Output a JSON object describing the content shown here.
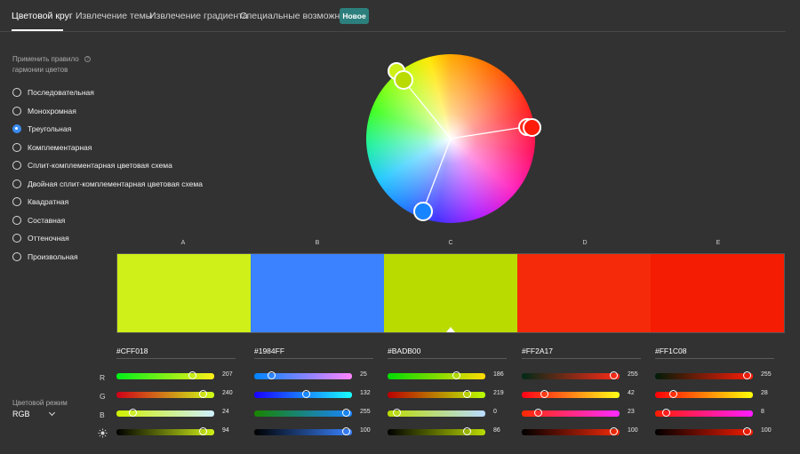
{
  "tabs": [
    {
      "label": "Цветовой круг",
      "active": true
    },
    {
      "label": "Извлечение темы",
      "active": false
    },
    {
      "label": "Извлечение градиента",
      "active": false
    },
    {
      "label": "Специальные возможности",
      "active": false
    }
  ],
  "badge": "Новое",
  "harmony": {
    "title": "Применить правило гармонии цветов",
    "rules": [
      {
        "label": "Последовательная",
        "checked": false
      },
      {
        "label": "Монохромная",
        "checked": false
      },
      {
        "label": "Треугольная",
        "checked": true
      },
      {
        "label": "Комплементарная",
        "checked": false
      },
      {
        "label": "Сплит-комплементарная цветовая схема",
        "checked": false
      },
      {
        "label": "Двойная сплит-комплементарная цветовая схема",
        "checked": false
      },
      {
        "label": "Квадратная",
        "checked": false
      },
      {
        "label": "Составная",
        "checked": false
      },
      {
        "label": "Оттеночная",
        "checked": false
      },
      {
        "label": "Произвольная",
        "checked": false
      }
    ]
  },
  "color_mode": {
    "title": "Цветовой режим",
    "value": "RGB"
  },
  "channels": [
    "R",
    "G",
    "B"
  ],
  "base_index": 2,
  "swatches": [
    {
      "label": "A",
      "hex": "#CFF018",
      "color": "#CFF018",
      "r": 207,
      "g": 240,
      "b": 24,
      "brightness": 94
    },
    {
      "label": "B",
      "hex": "#1984FF",
      "color": "#3A82FF",
      "r": 25,
      "g": 132,
      "b": 255,
      "brightness": 100
    },
    {
      "label": "C",
      "hex": "#BADB00",
      "color": "#BADB00",
      "r": 186,
      "g": 219,
      "b": 0,
      "brightness": 86
    },
    {
      "label": "D",
      "hex": "#FF2A17",
      "color": "#F52A0A",
      "r": 255,
      "g": 42,
      "b": 23,
      "brightness": 100
    },
    {
      "label": "E",
      "hex": "#FF1C08",
      "color": "#F41C02",
      "r": 255,
      "g": 28,
      "b": 8,
      "brightness": 100
    }
  ]
}
